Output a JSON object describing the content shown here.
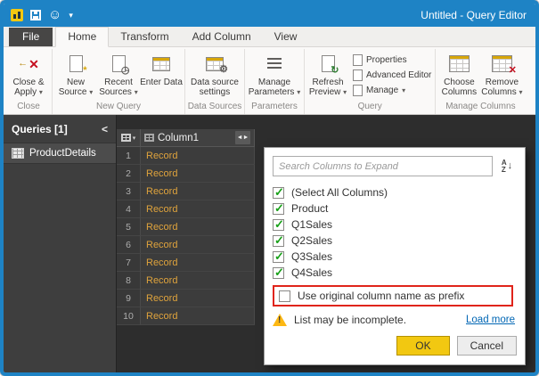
{
  "window": {
    "title": "Untitled - Query Editor"
  },
  "icons": {
    "caret_down": "▾",
    "collapse_left": "<",
    "smiley": "☺",
    "close_x": "✕",
    "back_arrow": "←",
    "new_source_mark": "*",
    "clock": "◷",
    "gear": "⚙",
    "refresh": "↻",
    "remove_x": "✕",
    "expand_arrows": "◄►",
    "grid_caret": "▾",
    "sort_a": "A",
    "sort_z": "Z",
    "sort_arrow": "↓"
  },
  "ribbon": {
    "tabs": [
      {
        "label": "File"
      },
      {
        "label": "Home"
      },
      {
        "label": "Transform"
      },
      {
        "label": "Add Column"
      },
      {
        "label": "View"
      }
    ],
    "groups": [
      {
        "label": "Close"
      },
      {
        "label": "New Query"
      },
      {
        "label": "Data Sources"
      },
      {
        "label": "Parameters"
      },
      {
        "label": "Query"
      },
      {
        "label": "Manage Columns"
      }
    ],
    "buttons": {
      "close_apply": "Close & Apply",
      "new_source": "New Source",
      "recent_sources": "Recent Sources",
      "enter_data": "Enter Data",
      "data_source_settings": "Data source settings",
      "manage_parameters": "Manage Parameters",
      "refresh_preview": "Refresh Preview",
      "properties": "Properties",
      "advanced_editor": "Advanced Editor",
      "manage": "Manage",
      "choose_columns": "Choose Columns",
      "remove_columns": "Remove Columns"
    }
  },
  "sidebar": {
    "header": "Queries [1]",
    "items": [
      {
        "label": "ProductDetails"
      }
    ]
  },
  "table": {
    "column": "Column1",
    "rows": [
      {
        "n": "1",
        "v": "Record"
      },
      {
        "n": "2",
        "v": "Record"
      },
      {
        "n": "3",
        "v": "Record"
      },
      {
        "n": "4",
        "v": "Record"
      },
      {
        "n": "5",
        "v": "Record"
      },
      {
        "n": "6",
        "v": "Record"
      },
      {
        "n": "7",
        "v": "Record"
      },
      {
        "n": "8",
        "v": "Record"
      },
      {
        "n": "9",
        "v": "Record"
      },
      {
        "n": "10",
        "v": "Record"
      }
    ]
  },
  "popup": {
    "search_placeholder": "Search Columns to Expand",
    "options": [
      {
        "label": "(Select All Columns)",
        "checked": true
      },
      {
        "label": "Product",
        "checked": true
      },
      {
        "label": "Q1Sales",
        "checked": true
      },
      {
        "label": "Q2Sales",
        "checked": true
      },
      {
        "label": "Q3Sales",
        "checked": true
      },
      {
        "label": "Q4Sales",
        "checked": true
      }
    ],
    "prefix_label": "Use original column name as prefix",
    "prefix_checked": false,
    "warning_text": "List may be incomplete.",
    "load_more_label": "Load more",
    "ok_label": "OK",
    "cancel_label": "Cancel"
  },
  "colors": {
    "titlebar_blue": "#1E83C5",
    "accent_yellow": "#F2C811",
    "record_text": "#DFA33C",
    "annotation_red": "#E0241B",
    "link_blue": "#0066B4",
    "check_green": "#18A018"
  }
}
